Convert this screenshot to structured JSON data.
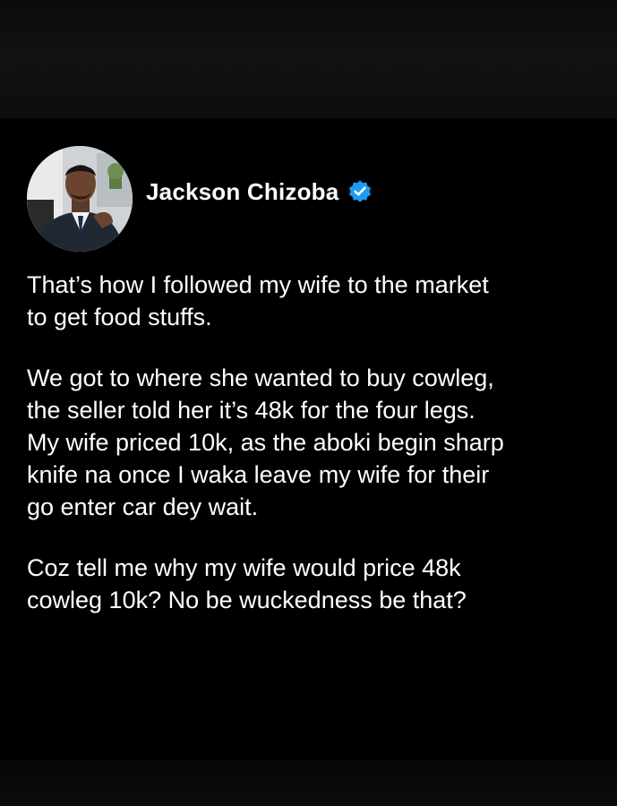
{
  "post": {
    "author": {
      "name": "Jackson Chizoba",
      "verified": true,
      "verified_badge_icon": "verified-check-icon",
      "badge_color": "#1d9bf0"
    },
    "paragraphs": [
      "That’s how I followed my wife to the market\nto get food stuffs.",
      "We got to where she wanted to buy cowleg,\nthe seller told her it’s 48k for the four legs.\nMy wife priced 10k, as the aboki begin sharp\nknife na once I waka leave my wife for their\ngo enter car dey wait.",
      "Coz tell me why my wife would price 48k\ncowleg 10k? No be wuckedness be that?"
    ]
  },
  "colors": {
    "background": "#000000",
    "text": "#ffffff"
  }
}
